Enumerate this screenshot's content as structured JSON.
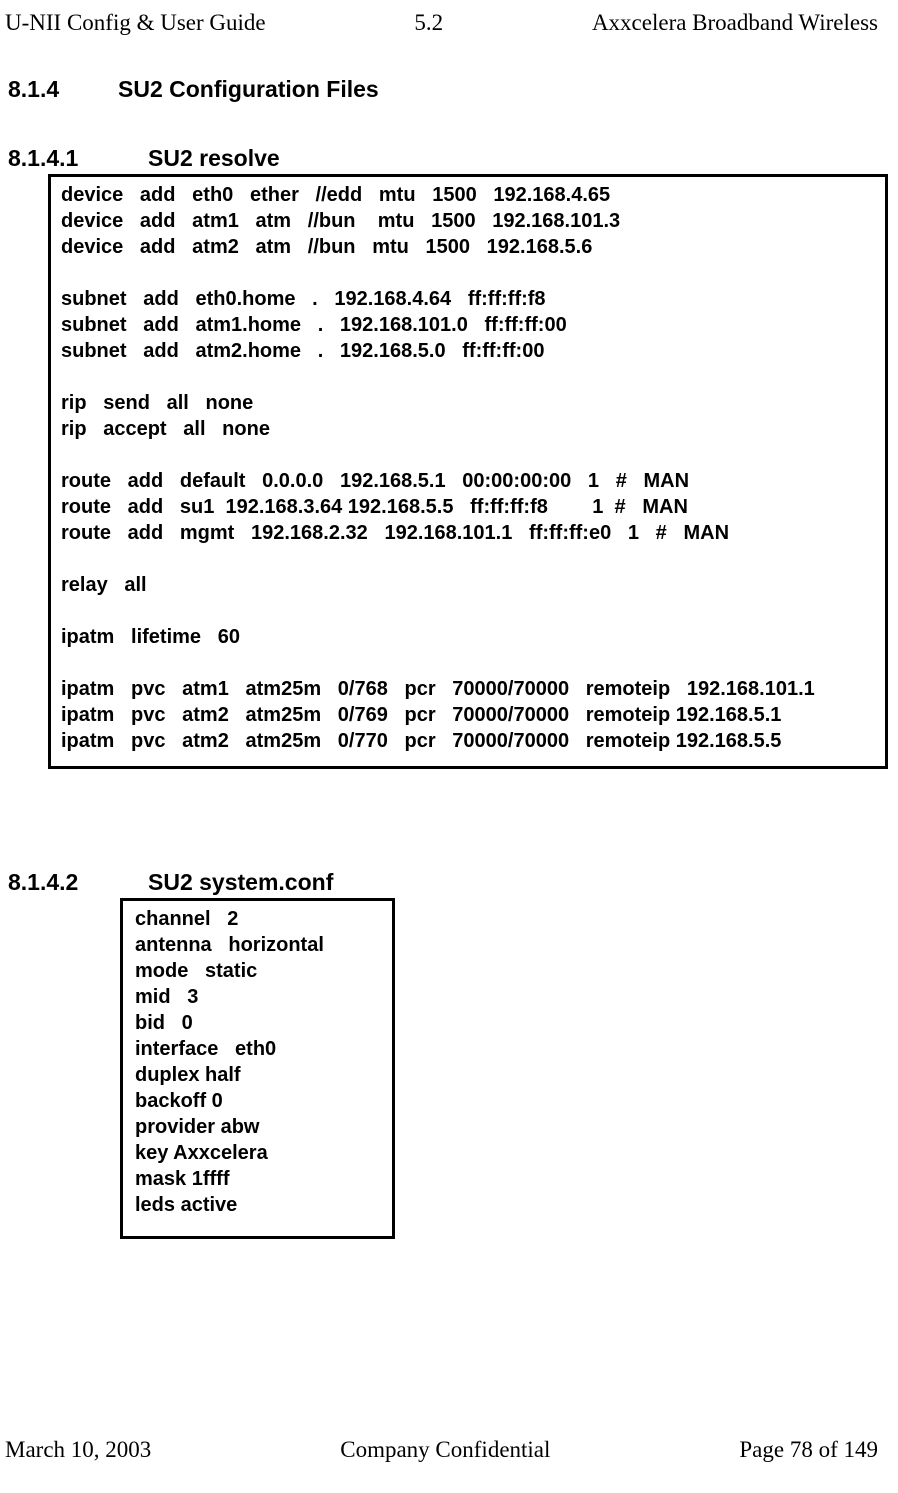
{
  "header": {
    "left": "U-NII Config & User Guide",
    "center": "5.2",
    "right": "Axxcelera Broadband Wireless"
  },
  "section_814": {
    "num": "8.1.4",
    "title": "SU2 Configuration Files"
  },
  "section_8141": {
    "num": "8.1.4.1",
    "title": "SU2 resolve",
    "code": "device   add   eth0   ether   //edd   mtu   1500   192.168.4.65\ndevice   add   atm1   atm   //bun    mtu   1500   192.168.101.3\ndevice   add   atm2   atm   //bun   mtu   1500   192.168.5.6\n\nsubnet   add   eth0.home   .   192.168.4.64   ff:ff:ff:f8\nsubnet   add   atm1.home   .   192.168.101.0   ff:ff:ff:00\nsubnet   add   atm2.home   .   192.168.5.0   ff:ff:ff:00\n\nrip   send   all   none\nrip   accept   all   none\n\nroute   add   default   0.0.0.0   192.168.5.1   00:00:00:00   1   #   MAN\nroute   add   su1  192.168.3.64 192.168.5.5   ff:ff:ff:f8        1  #   MAN\nroute   add   mgmt   192.168.2.32   192.168.101.1   ff:ff:ff:e0   1   #   MAN\n\nrelay   all\n\nipatm   lifetime   60\n\nipatm   pvc   atm1   atm25m   0/768   pcr   70000/70000   remoteip   192.168.101.1\nipatm   pvc   atm2   atm25m   0/769   pcr   70000/70000   remoteip 192.168.5.1\nipatm   pvc   atm2   atm25m   0/770   pcr   70000/70000   remoteip 192.168.5.5"
  },
  "section_8142": {
    "num": "8.1.4.2",
    "title": "SU2 system.conf",
    "code": "channel   2\nantenna   horizontal\nmode   static\nmid   3\nbid   0\ninterface   eth0\nduplex half\nbackoff 0\nprovider abw\nkey Axxcelera\nmask 1ffff\nleds active"
  },
  "footer": {
    "left": "March 10, 2003",
    "center": "Company Confidential",
    "right": "Page 78 of 149"
  }
}
